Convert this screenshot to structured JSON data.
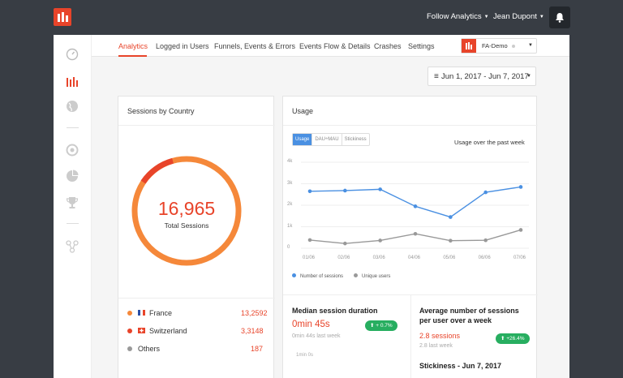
{
  "topbar": {
    "menu_label": "Follow Analytics",
    "user_label": "Jean Dupont"
  },
  "nav": {
    "items": [
      "Analytics",
      "Logged in Users",
      "Funnels, Events & Errors",
      "Events Flow & Details",
      "Crashes",
      "Settings"
    ],
    "active": "Analytics"
  },
  "app_select": {
    "value": "FA-Demo"
  },
  "date_range": {
    "value": "Jun 1, 2017 - Jun 7, 2017"
  },
  "sessions_by_country": {
    "title": "Sessions by Country",
    "total": "16,965",
    "total_label": "Total Sessions",
    "rows": [
      {
        "name": "France",
        "value": "13,2592",
        "color": "#f5883a"
      },
      {
        "name": "Switzerland",
        "value": "3,3148",
        "color": "#e8442a"
      },
      {
        "name": "Others",
        "value": "187",
        "color": "#999999"
      }
    ]
  },
  "usage": {
    "title": "Usage",
    "tabs": [
      "Usage",
      "DAU÷MAU",
      "Stickiness"
    ],
    "active_tab": "Usage",
    "caption": "Usage over the past week"
  },
  "chart_data": {
    "type": "line",
    "x": [
      "01/06",
      "02/06",
      "03/06",
      "04/06",
      "05/06",
      "06/06",
      "07/06"
    ],
    "y_ticks": [
      "4k",
      "3k",
      "2k",
      "1k",
      "0"
    ],
    "ylim": [
      0,
      4000
    ],
    "series": [
      {
        "name": "Number of sessions",
        "color": "#4a90e2",
        "values": [
          2650,
          2680,
          2740,
          1950,
          1450,
          2600,
          2850
        ]
      },
      {
        "name": "Unique users",
        "color": "#999999",
        "values": [
          380,
          220,
          360,
          670,
          350,
          370,
          850
        ]
      }
    ],
    "legend": "bottom-left",
    "grid": true
  },
  "median_session": {
    "title": "Median session duration",
    "value": "0min 45s",
    "previous": "0min 44s last week",
    "change": "+ 0.7%",
    "axis_label": "1min 0s"
  },
  "avg_sessions": {
    "title_line1": "Average number of sessions",
    "title_line2": "per user over a week",
    "value": "2.8 sessions",
    "previous": "2.8 last week",
    "change": "+26.4%"
  },
  "stickiness": {
    "title": "Stickiness - Jun 7, 2017"
  }
}
